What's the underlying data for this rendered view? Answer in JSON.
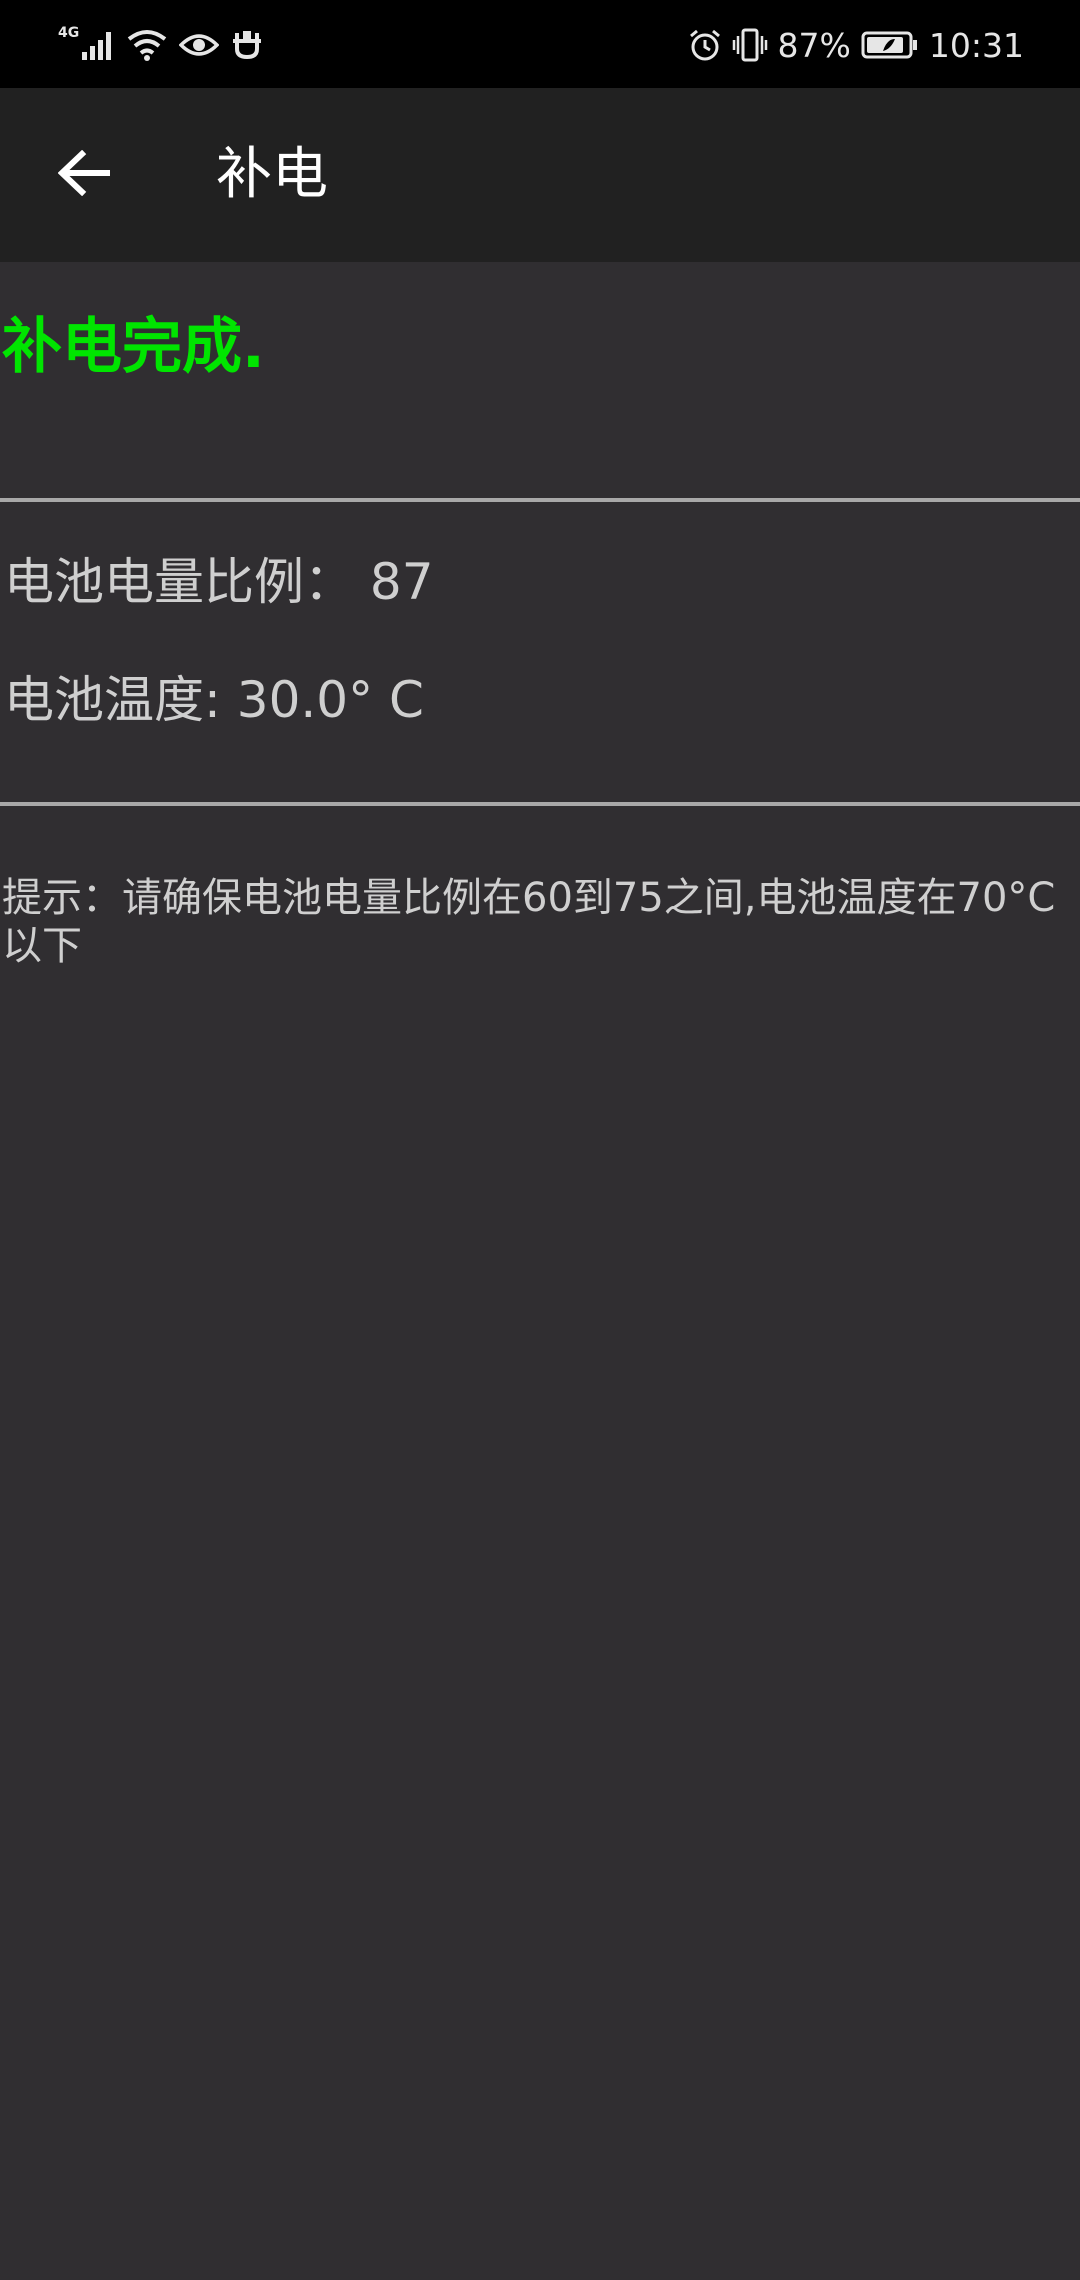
{
  "status_bar": {
    "network": "4G",
    "battery_percent": "87%",
    "time": "10:31",
    "left_icons": [
      "signal-icon",
      "wifi-icon",
      "eye-icon",
      "notification-icon"
    ],
    "right_icons": [
      "alarm-icon",
      "vibrate-icon",
      "battery-icon"
    ]
  },
  "toolbar": {
    "title": "补电",
    "back_icon": "arrow-left-icon"
  },
  "main": {
    "status_message": "补电完成.",
    "battery_level_label": "电池电量比例：",
    "battery_level_value": "87",
    "battery_temp_label": "电池温度:",
    "battery_temp_value": "30.0° C",
    "hint": "提示：请确保电池电量比例在60到75之间,电池温度在70°C以下"
  },
  "colors": {
    "background": "#302e31",
    "toolbar": "#212121",
    "status_bar": "#000000",
    "success": "#00e500",
    "text": "#cfcfcf",
    "divider": "#a8a8a8"
  }
}
